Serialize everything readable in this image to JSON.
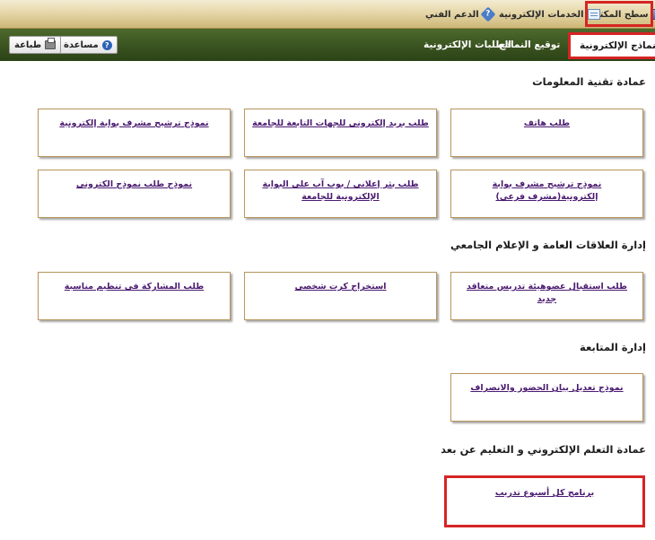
{
  "topbar": {
    "desktop": "سطح المكتب",
    "eservices": "الخدمات الإلكترونية",
    "support": "الدعم الفني"
  },
  "navbar": {
    "tabs": [
      "النماذج الإلكترونية",
      "توقيع النماذج",
      "الطلبات الإلكترونية"
    ],
    "help": "مساعدة",
    "print": "طباعة"
  },
  "sections": [
    {
      "title": "عمادة تقنية المعلومات",
      "cards": [
        "طلب هاتف",
        "طلب بريد إلكتروني للجهات التابعة للجامعة",
        "نموذج ترشيح مشرف بوابة إلكترونية",
        "نموذج ترشيح مشرف بوابة إلكترونية(مشرف فرعي)",
        "طلب بثر إعلاني / بوب آب على البوابة الإلكترونية للجامعة",
        "نموذج طلب نموذج الكتروني"
      ]
    },
    {
      "title": "إدارة العلاقات العامة و الإعلام الجامعي",
      "cards": [
        "طلب استقبال عضوهيئة تدريس متعاقد جديد",
        "استخراج كرت شخصي",
        "طلب المشاركة في تنظيم مناسبة"
      ]
    },
    {
      "title": "إدارة المتابعة",
      "cards": [
        "نموذج تعديل بيان الحضور والانصراف"
      ]
    },
    {
      "title": "عمادة التعلم الإلكتروني و التعليم عن بعد",
      "cards": [
        "برنامج كل أسبوع تدريب"
      ]
    }
  ],
  "colors": {
    "highlight": "#d62424",
    "nav_bg": "#3a5320",
    "link": "#4a1a70"
  }
}
